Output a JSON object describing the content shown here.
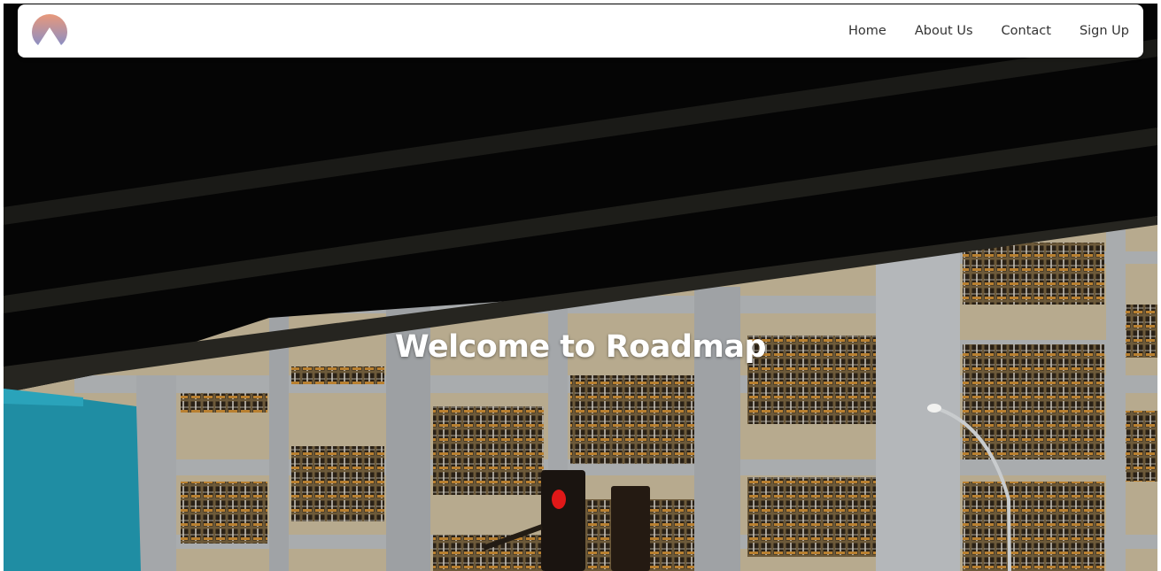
{
  "nav": {
    "logo": "mountain-logo-icon",
    "links": [
      "Home",
      "About Us",
      "Contact",
      "Sign Up"
    ]
  },
  "hero": {
    "title": "Welcome to Roadmap",
    "background": "photo of an office building beneath an overpass with a red traffic light"
  },
  "colors": {
    "navbar_bg": "#ffffff",
    "nav_text": "#333333",
    "logo_gradient_top": "#E8987A",
    "logo_gradient_bottom": "#8C8FC4",
    "hero_text": "#ffffff"
  }
}
